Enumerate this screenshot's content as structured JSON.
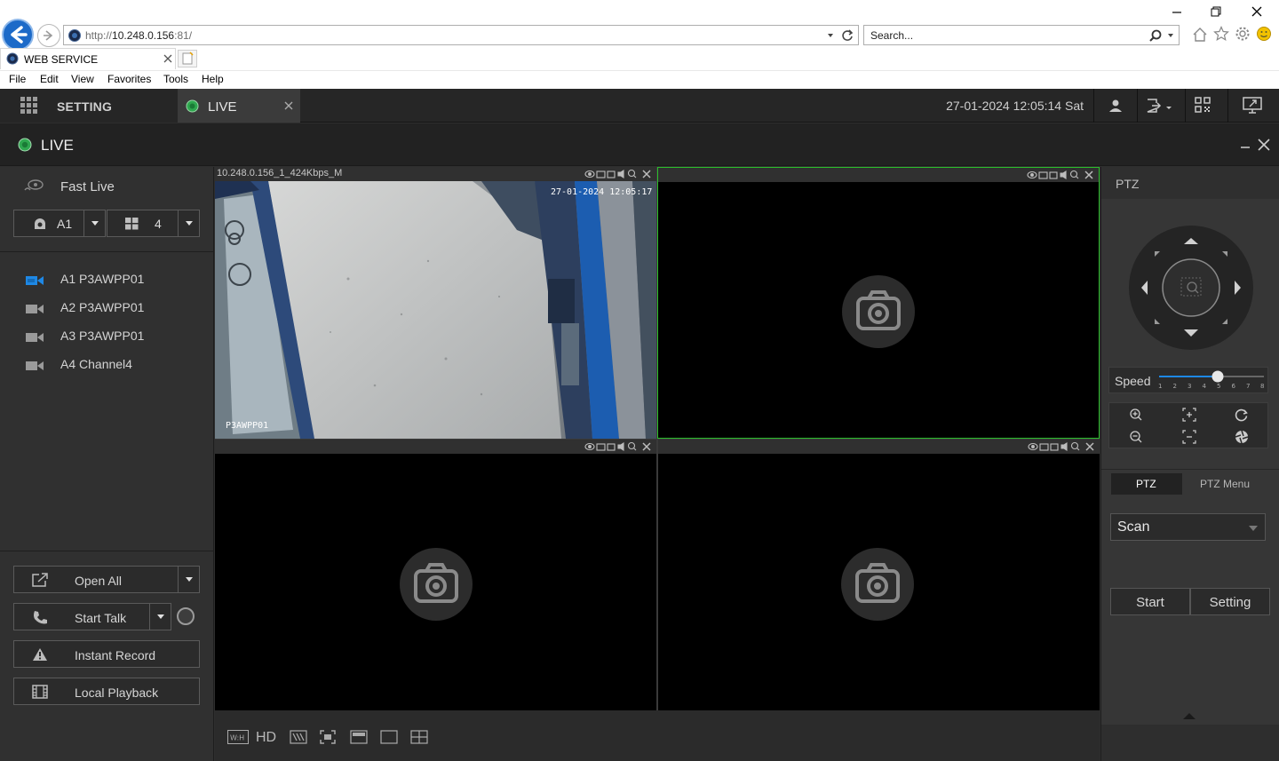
{
  "browser": {
    "url_prefix": "http://",
    "url_host": "10.248.0.156",
    "url_suffix": ":81/",
    "search_placeholder": "Search...",
    "tab_title": "WEB SERVICE",
    "menu": [
      "File",
      "Edit",
      "View",
      "Favorites",
      "Tools",
      "Help"
    ]
  },
  "header": {
    "setting_label": "SETTING",
    "live_tab_label": "LIVE",
    "datetime": "27-01-2024 12:05:14 Sat"
  },
  "live_bar": {
    "title": "LIVE"
  },
  "left_panel": {
    "fast_live": "Fast Live",
    "channel_select": "A1",
    "layout_select": "4",
    "channels": [
      {
        "label": "A1 P3AWPP01",
        "active": true
      },
      {
        "label": "A2 P3AWPP01",
        "active": false
      },
      {
        "label": "A3 P3AWPP01",
        "active": false
      },
      {
        "label": "A4 Channel4",
        "active": false
      }
    ],
    "buttons": {
      "open_all": "Open All",
      "start_talk": "Start Talk",
      "instant_record": "Instant Record",
      "local_playback": "Local Playback"
    }
  },
  "video": {
    "pane1_title": "10.248.0.156_1_424Kbps_M",
    "osd_time": "27-01-2024 12:05:17",
    "osd_name": "P3AWPP01"
  },
  "bottom_bar": {
    "hd_label": "HD"
  },
  "right_panel": {
    "ptz_title": "PTZ",
    "speed_label": "Speed",
    "speed_ticks": [
      "1",
      "2",
      "3",
      "4",
      "5",
      "6",
      "7",
      "8"
    ],
    "speed_value": 5,
    "tab_ptz": "PTZ",
    "tab_ptz_menu": "PTZ Menu",
    "scan_select": "Scan",
    "start_button": "Start",
    "setting_button": "Setting"
  },
  "colors": {
    "accent_blue": "#1e88e5",
    "active_pane_border": "#2bbf2b",
    "live_dot": "#2fa84f"
  }
}
